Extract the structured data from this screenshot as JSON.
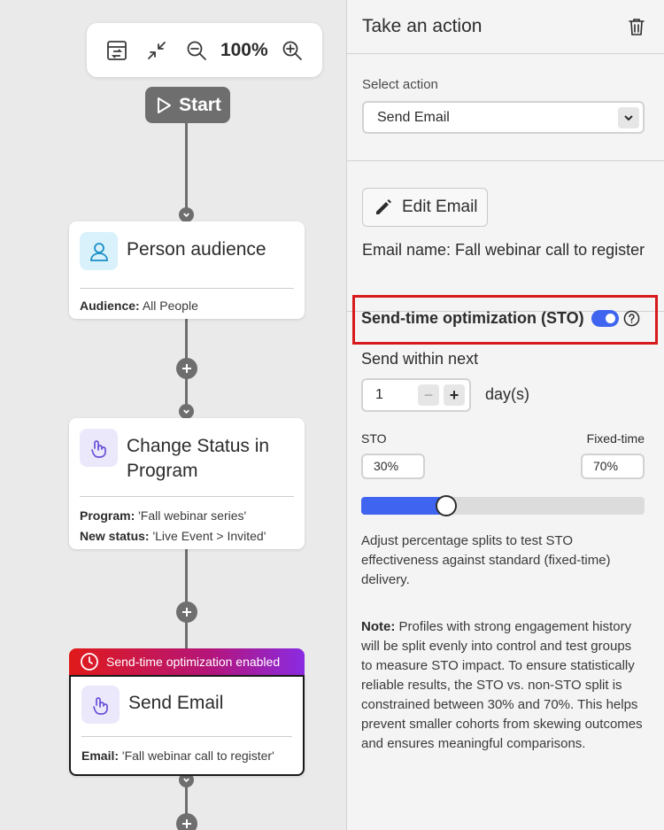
{
  "toolbar": {
    "zoom": "100%"
  },
  "start": {
    "label": "Start"
  },
  "nodes": {
    "audience": {
      "title": "Person audience",
      "meta_label": "Audience:",
      "meta_value": "All People"
    },
    "status": {
      "title": "Change Status in Program",
      "program_label": "Program:",
      "program_value": "'Fall webinar series'",
      "status_label": "New status:",
      "status_value": "'Live Event > Invited'"
    },
    "email": {
      "banner": "Send-time optimization enabled",
      "title": "Send Email",
      "meta_label": "Email:",
      "meta_value": "'Fall webinar call to register'"
    }
  },
  "panel": {
    "title": "Take an action",
    "select_label": "Select action",
    "select_value": "Send Email",
    "edit_label": "Edit Email",
    "email_name": "Email name: Fall webinar call to register",
    "sto_title": "Send-time optimization (STO)",
    "sto_enabled": true,
    "send_within": "Send within next",
    "stepper_value": "1",
    "minus": "−",
    "plus": "+",
    "days": "day(s)",
    "sto_label": "STO",
    "ft_label": "Fixed-time",
    "sto_pct": "30%",
    "ft_pct": "70%",
    "slider_fraction": 0.3,
    "description": "Adjust percentage splits to test STO effectiveness against standard (fixed-time) delivery.",
    "note_label": "Note:",
    "note_text": "Profiles with strong engagement history will be split evenly into control and test groups to measure STO impact. To ensure statistically reliable results, the STO vs. non-STO split is constrained between 30% and 70%. This helps prevent smaller cohorts from skewing outcomes and ensures meaningful comparisons."
  },
  "colors": {
    "accent": "#3e64f0",
    "highlight": "#d8191c",
    "connector": "#6e6e6e"
  }
}
